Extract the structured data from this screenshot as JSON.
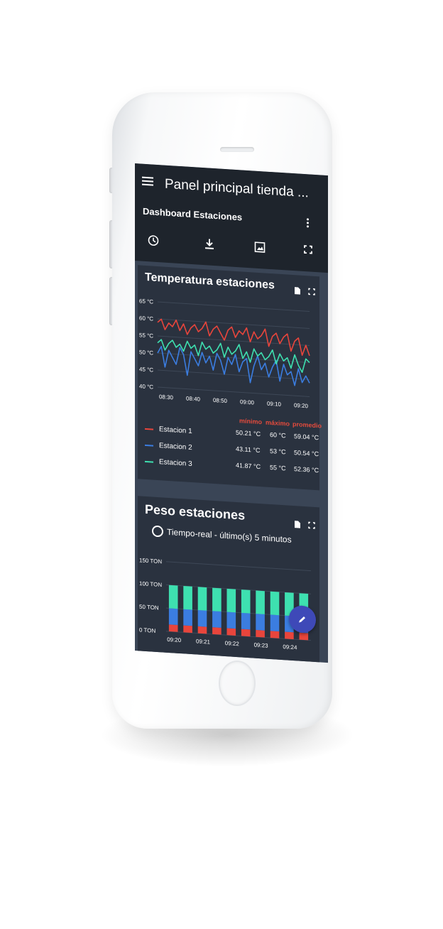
{
  "app": {
    "title": "Panel principal tienda ...",
    "subtitle": "Dashboard Estaciones"
  },
  "toolbar": {
    "icons": [
      "clock-icon",
      "download-icon",
      "image-icon",
      "fullscreen-icon"
    ]
  },
  "temperature_card": {
    "title": "Temperatura estaciones",
    "stat_headers": {
      "min": "mínimo",
      "max": "máximo",
      "avg": "promedio"
    },
    "legend": [
      {
        "name": "Estacion 1",
        "color": "#e8453c",
        "min": "50.21 °C",
        "max": "60 °C",
        "avg": "59.04 °C"
      },
      {
        "name": "Estacion 2",
        "color": "#3b7de0",
        "min": "43.11 °C",
        "max": "53 °C",
        "avg": "50.54 °C"
      },
      {
        "name": "Estacion 3",
        "color": "#3ee0b0",
        "min": "41.87 °C",
        "max": "55 °C",
        "avg": "52.36 °C"
      }
    ]
  },
  "weight_card": {
    "title": "Peso estaciones",
    "realtime_label": "Tiempo-real - último(s) 5 minutos"
  },
  "chart_data": [
    {
      "type": "line",
      "title": "Temperatura estaciones",
      "x_ticks": [
        "08:30",
        "08:40",
        "08:50",
        "09:00",
        "09:10",
        "09:20"
      ],
      "y_ticks": [
        "65 °C",
        "60 °C",
        "55 °C",
        "50 °C",
        "45 °C",
        "40 °C"
      ],
      "ylim": [
        40,
        65
      ],
      "series": [
        {
          "name": "Estacion 1",
          "color": "#e8453c",
          "values": [
            59,
            60,
            57,
            59,
            58,
            60,
            57,
            59,
            56,
            58,
            59,
            57,
            58,
            60,
            56,
            58,
            59,
            57,
            55,
            58,
            59,
            56,
            58,
            57,
            59,
            55,
            58,
            56,
            57,
            59,
            54,
            57,
            58,
            55,
            57,
            58,
            53,
            56,
            57,
            52,
            55,
            52
          ]
        },
        {
          "name": "Estacion 2",
          "color": "#3b7de0",
          "values": [
            50,
            52,
            46,
            51,
            49,
            47,
            52,
            50,
            44,
            51,
            49,
            47,
            51,
            48,
            50,
            46,
            51,
            49,
            45,
            50,
            48,
            51,
            46,
            49,
            50,
            43,
            48,
            51,
            47,
            49,
            45,
            48,
            50,
            44,
            49,
            46,
            47,
            43,
            48,
            44,
            46,
            44
          ]
        },
        {
          "name": "Estacion 3",
          "color": "#3ee0b0",
          "values": [
            53,
            54,
            51,
            53,
            54,
            52,
            53,
            51,
            54,
            52,
            53,
            50,
            54,
            52,
            53,
            51,
            52,
            54,
            50,
            53,
            51,
            52,
            54,
            50,
            52,
            49,
            53,
            51,
            52,
            50,
            51,
            53,
            49,
            52,
            50,
            51,
            48,
            52,
            49,
            47,
            51,
            50
          ]
        }
      ]
    },
    {
      "type": "bar",
      "title": "Peso estaciones",
      "x_ticks": [
        "09:20",
        "09:21",
        "09:22",
        "09:23",
        "09:24"
      ],
      "y_ticks": [
        "150 TON",
        "100 TON",
        "50 TON",
        "0 TON"
      ],
      "ylim": [
        0,
        150
      ],
      "series": [
        {
          "name": "Estacion 1",
          "color": "#e8453c",
          "values": [
            15,
            15,
            15,
            15,
            15,
            15,
            15,
            15,
            15,
            15
          ]
        },
        {
          "name": "Estacion 2",
          "color": "#3b7de0",
          "values": [
            35,
            35,
            35,
            35,
            35,
            35,
            35,
            35,
            35,
            35
          ]
        },
        {
          "name": "Estacion 3",
          "color": "#3ee0b0",
          "values": [
            50,
            50,
            50,
            50,
            50,
            50,
            50,
            50,
            50,
            50
          ]
        }
      ]
    }
  ]
}
